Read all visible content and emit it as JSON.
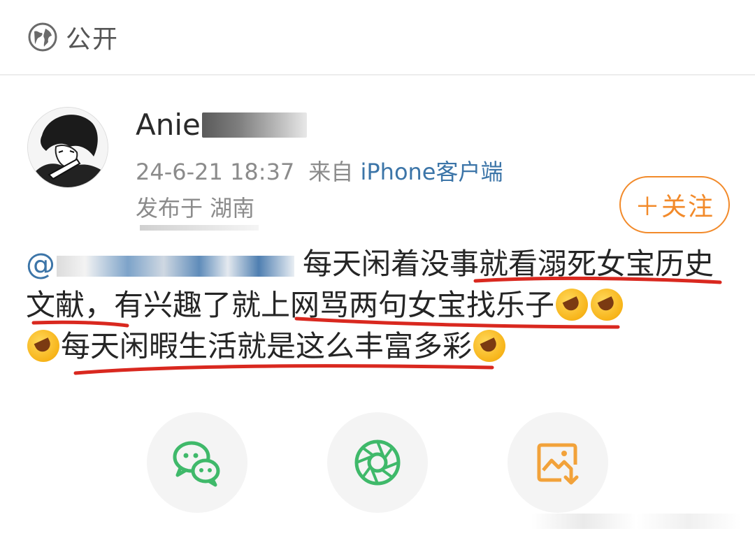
{
  "visibility": {
    "icon": "globe-icon",
    "label": "公开"
  },
  "author": {
    "name_visible": "Anie",
    "timestamp": "24-6-21 18:37",
    "source_prefix": "来自",
    "source_client": "iPhone客户端",
    "location": "发布于 湖南"
  },
  "follow_button": {
    "label": "＋关注"
  },
  "post": {
    "mention_prefix": "@",
    "segment_1": "每天闲着没事就看溺死女宝历史文献，有兴趣了就上网骂两句女宝找乐子",
    "segment_2": "每天闲暇生活就是这么丰富多彩"
  },
  "share": [
    {
      "name": "wechat",
      "icon": "wechat-icon"
    },
    {
      "name": "moments",
      "icon": "moments-icon"
    },
    {
      "name": "save-image",
      "icon": "save-image-icon"
    }
  ],
  "colors": {
    "accent": "#f28a2a",
    "link": "#3c75a8",
    "annotation": "#d9281f",
    "wechat": "#3fb96a"
  }
}
